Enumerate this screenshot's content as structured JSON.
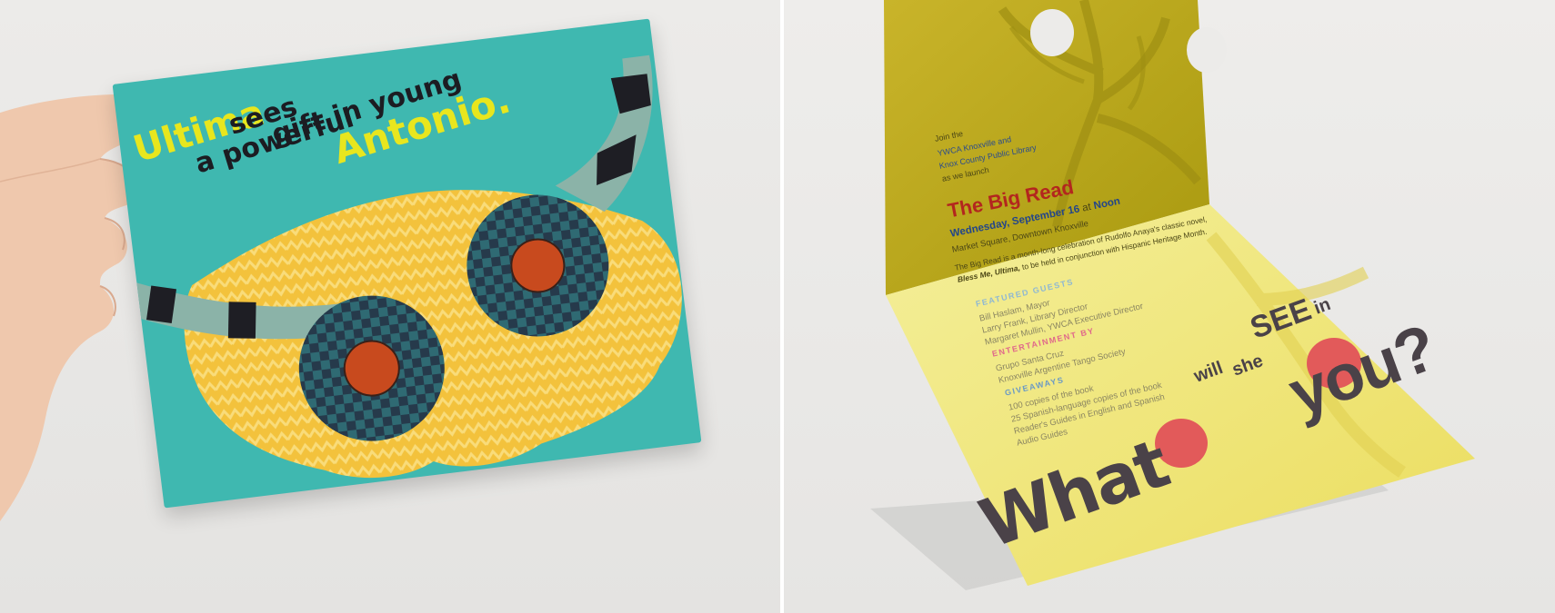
{
  "left_card": {
    "line1": "Ultima",
    "line2": "sees",
    "line3": "a powerful",
    "line4": "gift in young",
    "line5": "Antonio."
  },
  "right_card": {
    "intro": {
      "line1": "Join the",
      "line2": "YWCA Knoxville and",
      "line3": "Knox County Public Library",
      "line4": "as we launch"
    },
    "event_title": "The Big Read",
    "event_when_part1": "Wednesday, September 16",
    "event_when_part2": "at",
    "event_when_part3": "Noon",
    "event_where": "Market Square, Downtown Knoxville",
    "description_line1": "The Big Read is a month-long celebration of Rudolfo Anaya's classic novel,",
    "description_line2_bold": "Bless Me, Ultima,",
    "description_line2_rest": "to be held in conjunction with Hispanic Heritage Month.",
    "featured_label": "FEATURED GUESTS",
    "featured_items": [
      "Bill Haslam, Mayor",
      "Larry Frank, Library Director",
      "Margaret Mullin, YWCA Executive Director"
    ],
    "entertainment_label": "ENTERTAINMENT BY",
    "entertainment_items": [
      "Grupo Santa Cruz",
      "Knoxville Argentine Tango Society"
    ],
    "giveaways_label": "GIVEAWAYS",
    "giveaways_items": [
      "100 copies of the book",
      "25 Spanish-language copies of the book",
      "Reader's Guides in English and Spanish",
      "Audio Guides"
    ],
    "slogan_what": "What",
    "slogan_will": "will",
    "slogan_she": "she",
    "slogan_see": "SEE",
    "slogan_in": "in",
    "slogan_you": "you?"
  },
  "colors": {
    "teal": "#3fb8b0",
    "yellow_text": "#e8e61e",
    "card_olive": "#b9a81e",
    "card_pale_yellow": "#f1ea7a",
    "title_red": "#b3261e",
    "slogan_grey": "#4a4248",
    "slogan_red_dot": "#e25a5a"
  }
}
